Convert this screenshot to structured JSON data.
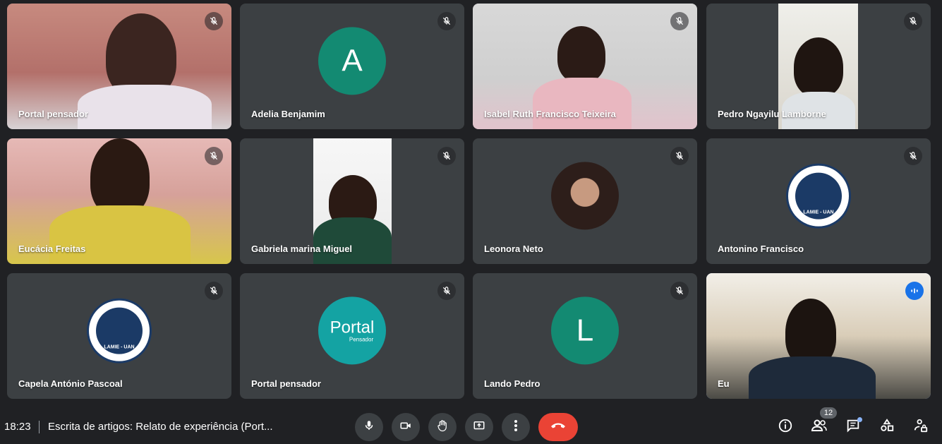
{
  "participants": [
    {
      "name": "Portal pensador",
      "type": "video"
    },
    {
      "name": "Adelia Benjamim",
      "type": "initial",
      "initial": "A",
      "color": "#138a72"
    },
    {
      "name": "Isabel Ruth Francisco Teixeira",
      "type": "video"
    },
    {
      "name": "Pedro Ngayilu Lamborne",
      "type": "video"
    },
    {
      "name": "Eucácia Freitas",
      "type": "video"
    },
    {
      "name": "Gabriela marina Miguel",
      "type": "video"
    },
    {
      "name": "Leonora Neto",
      "type": "photo"
    },
    {
      "name": "Antonino Francisco",
      "type": "logo",
      "logo_text": "LAMIE - UAN"
    },
    {
      "name": "Capela António Pascoal",
      "type": "logo",
      "logo_text": "LAMIE - UAN"
    },
    {
      "name": "Portal pensador",
      "type": "brand",
      "brand_main": "Portal",
      "brand_sub": "Pensador"
    },
    {
      "name": "Lando Pedro",
      "type": "initial",
      "initial": "L",
      "color": "#138a72"
    },
    {
      "name": "Eu",
      "type": "video",
      "speaking": true
    }
  ],
  "bottom_bar": {
    "time": "18:23",
    "meeting_title": "Escrita de artigos: Relato de experiência (Port...",
    "participant_count": "12"
  },
  "colors": {
    "background": "#202124",
    "tile": "#3c4043",
    "end_call": "#ea4335",
    "active_speaker": "#1a73e8"
  }
}
